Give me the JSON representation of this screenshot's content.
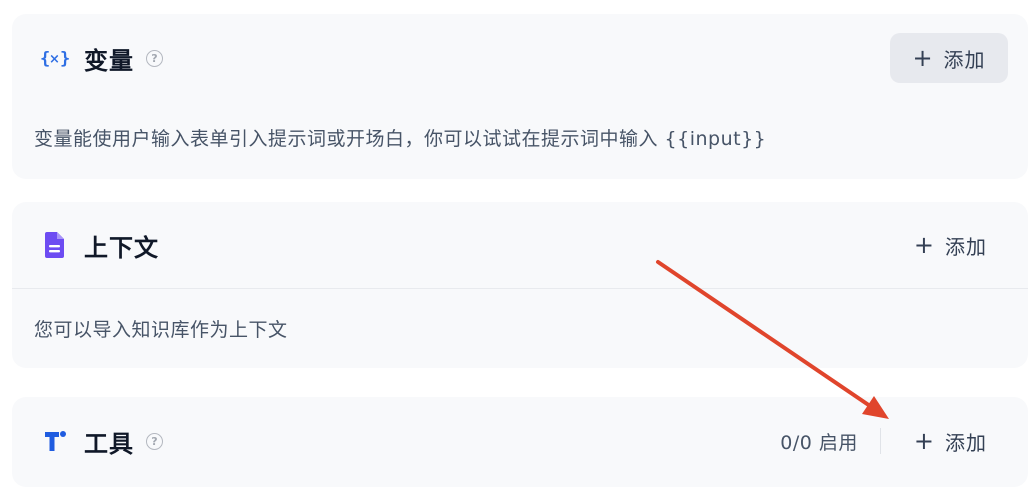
{
  "variables": {
    "icon": "variable-braces-icon",
    "title": "变量",
    "add_label": "添加",
    "description": "变量能使用户输入表单引入提示词或开场白，你可以试试在提示词中输入 {{input}}"
  },
  "context": {
    "icon": "document-icon",
    "title": "上下文",
    "add_label": "添加",
    "description": "您可以导入知识库作为上下文"
  },
  "tools": {
    "icon": "tool-t-icon",
    "title": "工具",
    "status": "0/0 启用",
    "add_label": "添加"
  },
  "annotation": {
    "arrow_color": "#e0452c"
  },
  "colors": {
    "card_bg": "#f8f9fb",
    "variable_icon": "#2f6fe4",
    "context_icon": "#6d4cf2",
    "tools_icon": "#1f5ce0"
  }
}
